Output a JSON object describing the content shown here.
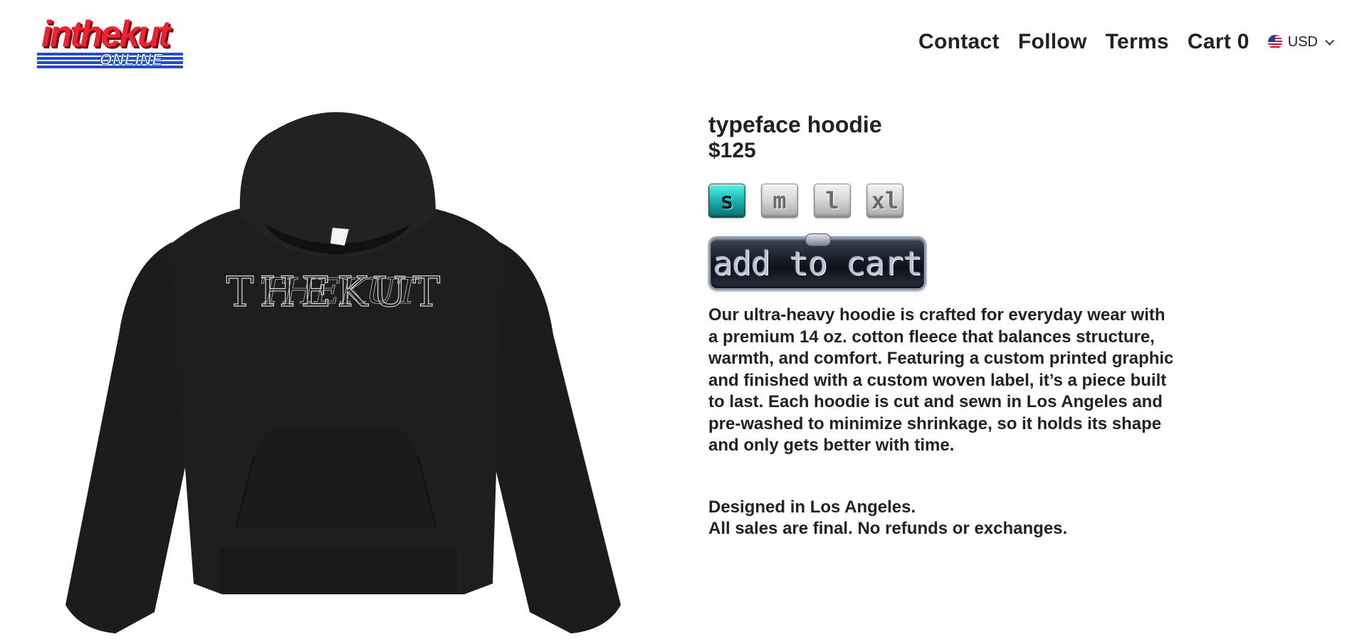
{
  "brand": {
    "logo_main": "inthekut",
    "logo_sub": "ONLINE"
  },
  "nav": {
    "items": [
      {
        "label": "Contact"
      },
      {
        "label": "Follow"
      },
      {
        "label": "Terms"
      },
      {
        "label": "Cart 0"
      }
    ],
    "currency": "USD",
    "currency_flag_icon": "us-flag-icon"
  },
  "product": {
    "title": "typeface hoodie",
    "price": "$125",
    "sizes": [
      {
        "label": "s",
        "selected": true
      },
      {
        "label": "m",
        "selected": false
      },
      {
        "label": "l",
        "selected": false
      },
      {
        "label": "xl",
        "selected": false
      }
    ],
    "add_to_cart_label": "add to cart",
    "description": "Our ultra-heavy hoodie is crafted for everyday wear with a premium 14 oz. cotton fleece that balances structure, warmth, and comfort. Featuring a custom printed graphic and finished with a custom woven label, it’s a piece built to last. Each hoodie is cut and sewn in Los Angeles and pre-washed to minimize shrinkage, so it holds its shape and only gets better with time.",
    "notes": [
      "Designed in Los Angeles.",
      "All sales are final. No refunds or exchanges."
    ],
    "graphic_text": "THEKUT"
  },
  "colors": {
    "logo_red": "#ee2233",
    "logo_blue": "#1f4fc8",
    "selected_size": "#1bbbb7",
    "hoodie": "#1c1c1e",
    "text": "#222222"
  }
}
